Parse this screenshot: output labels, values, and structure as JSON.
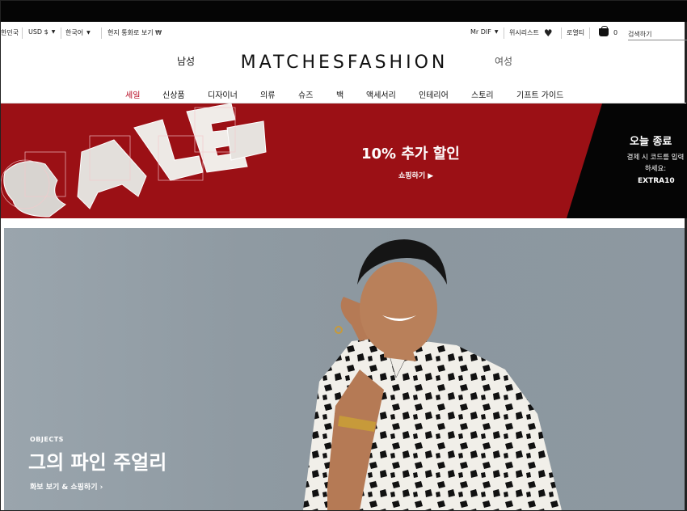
{
  "utility": {
    "country": "한민국",
    "currency": "USD $",
    "language": "한국어",
    "local_currency": "현지 통화로 보기 ₩",
    "account": "Mr DIF",
    "wishlist": "위시리스트",
    "loyalty": "로열티",
    "cart_count": "0",
    "search_placeholder": "검색하기"
  },
  "header": {
    "men_label": "남성",
    "logo": "MATCHESFASHION",
    "women_label": "여성"
  },
  "nav": {
    "items": [
      "세일",
      "신상품",
      "디자이너",
      "의류",
      "슈즈",
      "백",
      "액세서리",
      "인테리어",
      "스토리",
      "기프트 가이드"
    ]
  },
  "sale_banner": {
    "title": "10% 추가 할인",
    "link": "쇼핑하기 ▶",
    "right_title": "오늘 종료",
    "right_subtitle": "결제 시 코드를 입력하세요:",
    "code": "EXTRA10"
  },
  "hero": {
    "category": "OBJECTS",
    "title": "그의 파인 주얼리",
    "link": "화보 보기 & 쇼핑하기 ›"
  },
  "colors": {
    "sale_red": "#9b1015",
    "sale_nav_red": "#b4001a",
    "black": "#050505",
    "hero_bg": "#8f9aa2"
  }
}
